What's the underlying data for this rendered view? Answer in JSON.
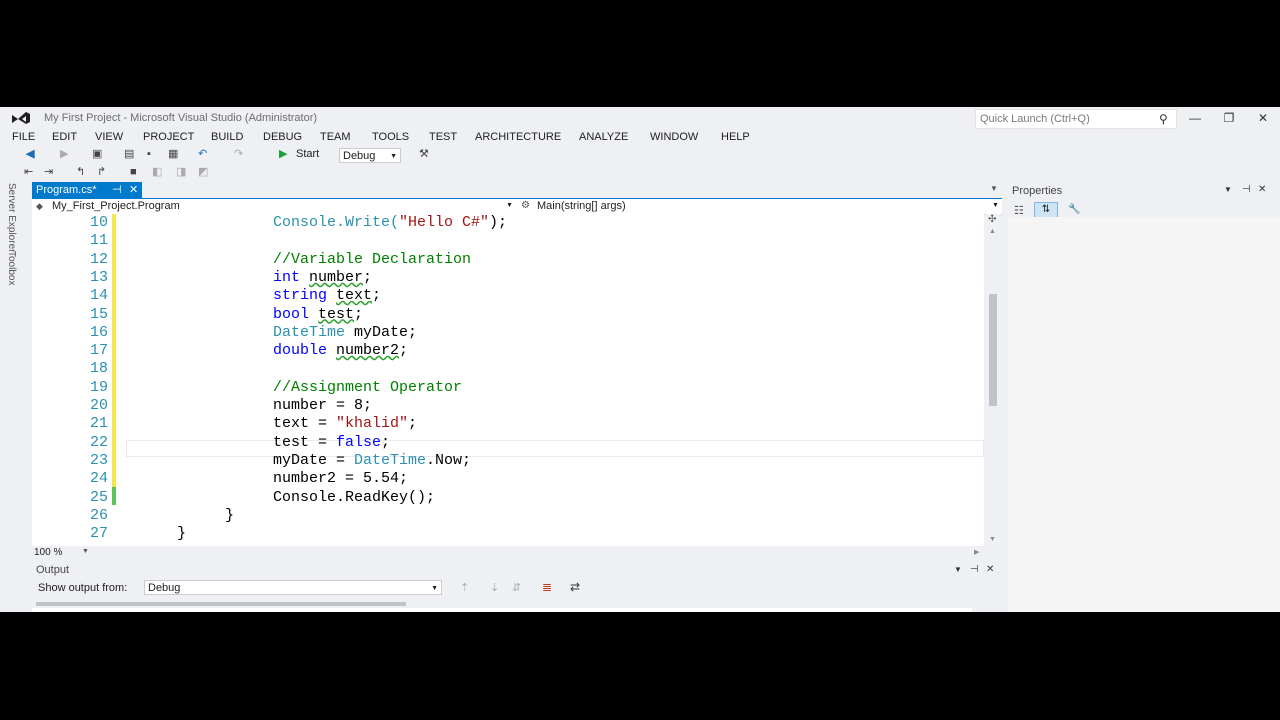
{
  "window": {
    "title": "My First Project - Microsoft Visual Studio (Administrator)",
    "quick_launch_placeholder": "Quick Launch (Ctrl+Q)",
    "minimize": "—",
    "maximize": "❐",
    "close": "✕"
  },
  "menu": [
    "FILE",
    "EDIT",
    "VIEW",
    "PROJECT",
    "BUILD",
    "DEBUG",
    "TEAM",
    "TOOLS",
    "TEST",
    "ARCHITECTURE",
    "ANALYZE",
    "WINDOW",
    "HELP"
  ],
  "toolbar": {
    "start_label": "Start",
    "config_value": "Debug"
  },
  "side_tabs": [
    "Server Explorer",
    "Toolbox"
  ],
  "doc_tab": {
    "label": "Program.cs*",
    "pin": "⊣",
    "close": "✕"
  },
  "navbar": {
    "class_dropdown": "My_First_Project.Program",
    "member_dropdown": "Main(string[] args)"
  },
  "editor": {
    "zoom": "100 %",
    "lines": [
      {
        "num": "10"
      },
      {
        "num": "11"
      },
      {
        "num": "12"
      },
      {
        "num": "13"
      },
      {
        "num": "14"
      },
      {
        "num": "15"
      },
      {
        "num": "16"
      },
      {
        "num": "17"
      },
      {
        "num": "18"
      },
      {
        "num": "19"
      },
      {
        "num": "20"
      },
      {
        "num": "21"
      },
      {
        "num": "22"
      },
      {
        "num": "23"
      },
      {
        "num": "24"
      },
      {
        "num": "25"
      },
      {
        "num": "26"
      },
      {
        "num": "27"
      }
    ],
    "code": {
      "l10a": "Console.Write(",
      "l10b": "\"Hello C#\"",
      "l10c": ");",
      "l12": "//Variable Declaration",
      "l13a": "int",
      "l13b": "number",
      "l13c": ";",
      "l14a": "string",
      "l14b": "text",
      "l14c": ";",
      "l15a": "bool",
      "l15b": "test",
      "l15c": ";",
      "l16a": "DateTime",
      "l16b": " myDate;",
      "l17a": "double",
      "l17b": "number2",
      "l17c": ";",
      "l19": "//Assignment Operator",
      "l20": "number = 8;",
      "l21a": "text = ",
      "l21b": "\"khalid\"",
      "l21c": ";",
      "l22a": "test = ",
      "l22b": "false",
      "l22c": ";",
      "l23a": "myDate = ",
      "l23b": "DateTime",
      "l23c": ".Now;",
      "l24": "number2 = 5.54;",
      "l25": "Console.ReadKey();",
      "l26": "}",
      "l27": "}"
    }
  },
  "properties": {
    "title": "Properties"
  },
  "output": {
    "title": "Output",
    "show_from_label": "Show output from:",
    "source_value": "Debug"
  }
}
